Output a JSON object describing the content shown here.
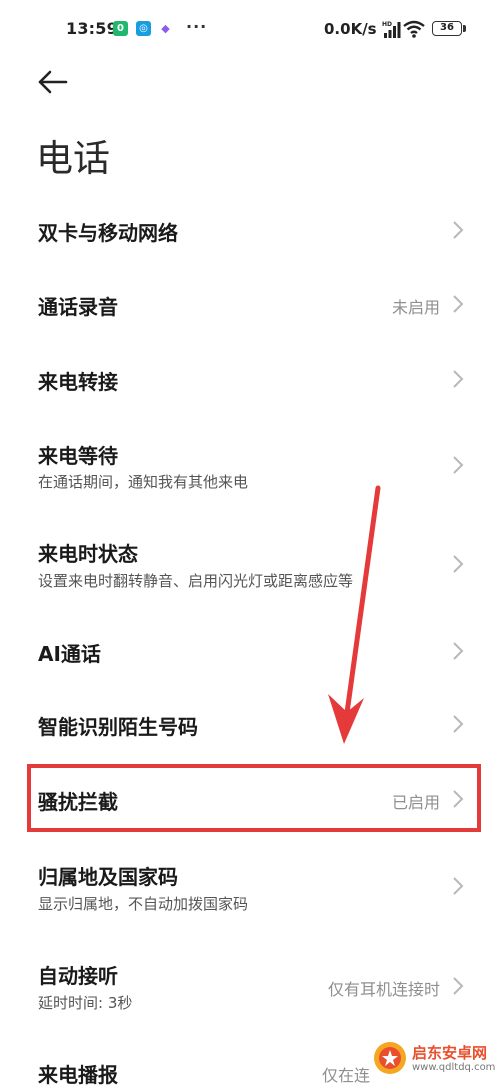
{
  "status_bar": {
    "time": "13:59",
    "dots": "···",
    "network_speed": "0.0K/s",
    "battery": "36",
    "app_icons": [
      {
        "name": "app-notification-icon-1",
        "color": "#1fb86e",
        "glyph": "0"
      },
      {
        "name": "app-notification-icon-2",
        "color": "#1a9de0",
        "glyph": "◎"
      },
      {
        "name": "app-notification-icon-3",
        "color": "#8a5cf0",
        "glyph": "◆"
      }
    ]
  },
  "page": {
    "title": "电话"
  },
  "settings": [
    {
      "id": "dual-sim",
      "label": "双卡与移动网络",
      "subtitle": "",
      "value": ""
    },
    {
      "id": "call-recording",
      "label": "通话录音",
      "subtitle": "",
      "value": "未启用"
    },
    {
      "id": "call-forwarding",
      "label": "来电转接",
      "subtitle": "",
      "value": ""
    },
    {
      "id": "call-waiting",
      "label": "来电等待",
      "subtitle": "在通话期间，通知我有其他来电",
      "value": ""
    },
    {
      "id": "incoming-call-status",
      "label": "来电时状态",
      "subtitle": "设置来电时翻转静音、启用闪光灯或距离感应等",
      "value": ""
    },
    {
      "id": "ai-call",
      "label": "AI通话",
      "subtitle": "",
      "value": ""
    },
    {
      "id": "identify-unknown-numbers",
      "label": "智能识别陌生号码",
      "subtitle": "",
      "value": ""
    },
    {
      "id": "harassment-block",
      "label": "骚扰拦截",
      "subtitle": "",
      "value": "已启用"
    },
    {
      "id": "location-country-code",
      "label": "归属地及国家码",
      "subtitle": "显示归属地，不自动加拨国家码",
      "value": ""
    },
    {
      "id": "auto-answer",
      "label": "自动接听",
      "subtitle": "延时时间: 3秒",
      "value": "仅有耳机连接时"
    },
    {
      "id": "caller-announcement",
      "label": "来电播报",
      "subtitle": "",
      "value": "仅在连"
    }
  ],
  "watermark": {
    "title": "启东安卓网",
    "url": "www.qdltdq.com"
  },
  "colors": {
    "highlight": "#e43a3a",
    "chevron": "#b8b8b8",
    "value_text": "#8f8f8f"
  }
}
